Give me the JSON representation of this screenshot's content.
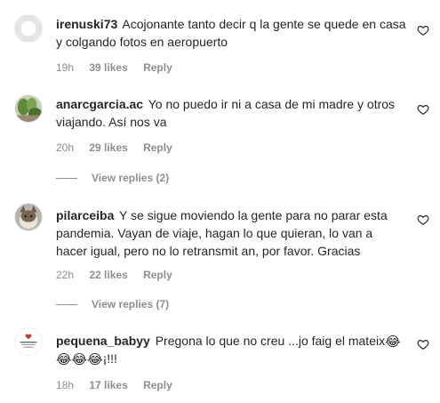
{
  "comments": [
    {
      "username": "irenuski73",
      "text": "Acojonante tanto decir q la gente se quede en casa y colgando fotos en aeropuerto",
      "time": "19h",
      "likes": "39 likes",
      "reply": "Reply"
    },
    {
      "username": "anarcgarcia.ac",
      "text": "Yo no puedo ir ni a casa de mi madre y otros viajando. Así nos va",
      "time": "20h",
      "likes": "29 likes",
      "reply": "Reply",
      "view_replies": "View replies (2)"
    },
    {
      "username": "pilarceiba",
      "text": "Y se sigue moviendo la gente para no parar esta pandemia. Vayan de viaje, hagan lo que quieran, lo van a hacer igual, pero no lo retransmit an, por favor. Gracias",
      "time": "22h",
      "likes": "22 likes",
      "reply": "Reply",
      "view_replies": "View replies (7)"
    },
    {
      "username": "pequena_babyy",
      "text_before": "Pregona lo que no creu ...jo faig el mateix",
      "text_after": "¡!!!",
      "emoji": "😂",
      "time": "18h",
      "likes": "17 likes",
      "reply": "Reply"
    }
  ],
  "icons": {
    "like": "heart-outline-icon"
  },
  "colors": {
    "text": "#262626",
    "secondary": "#8e8e8e"
  }
}
